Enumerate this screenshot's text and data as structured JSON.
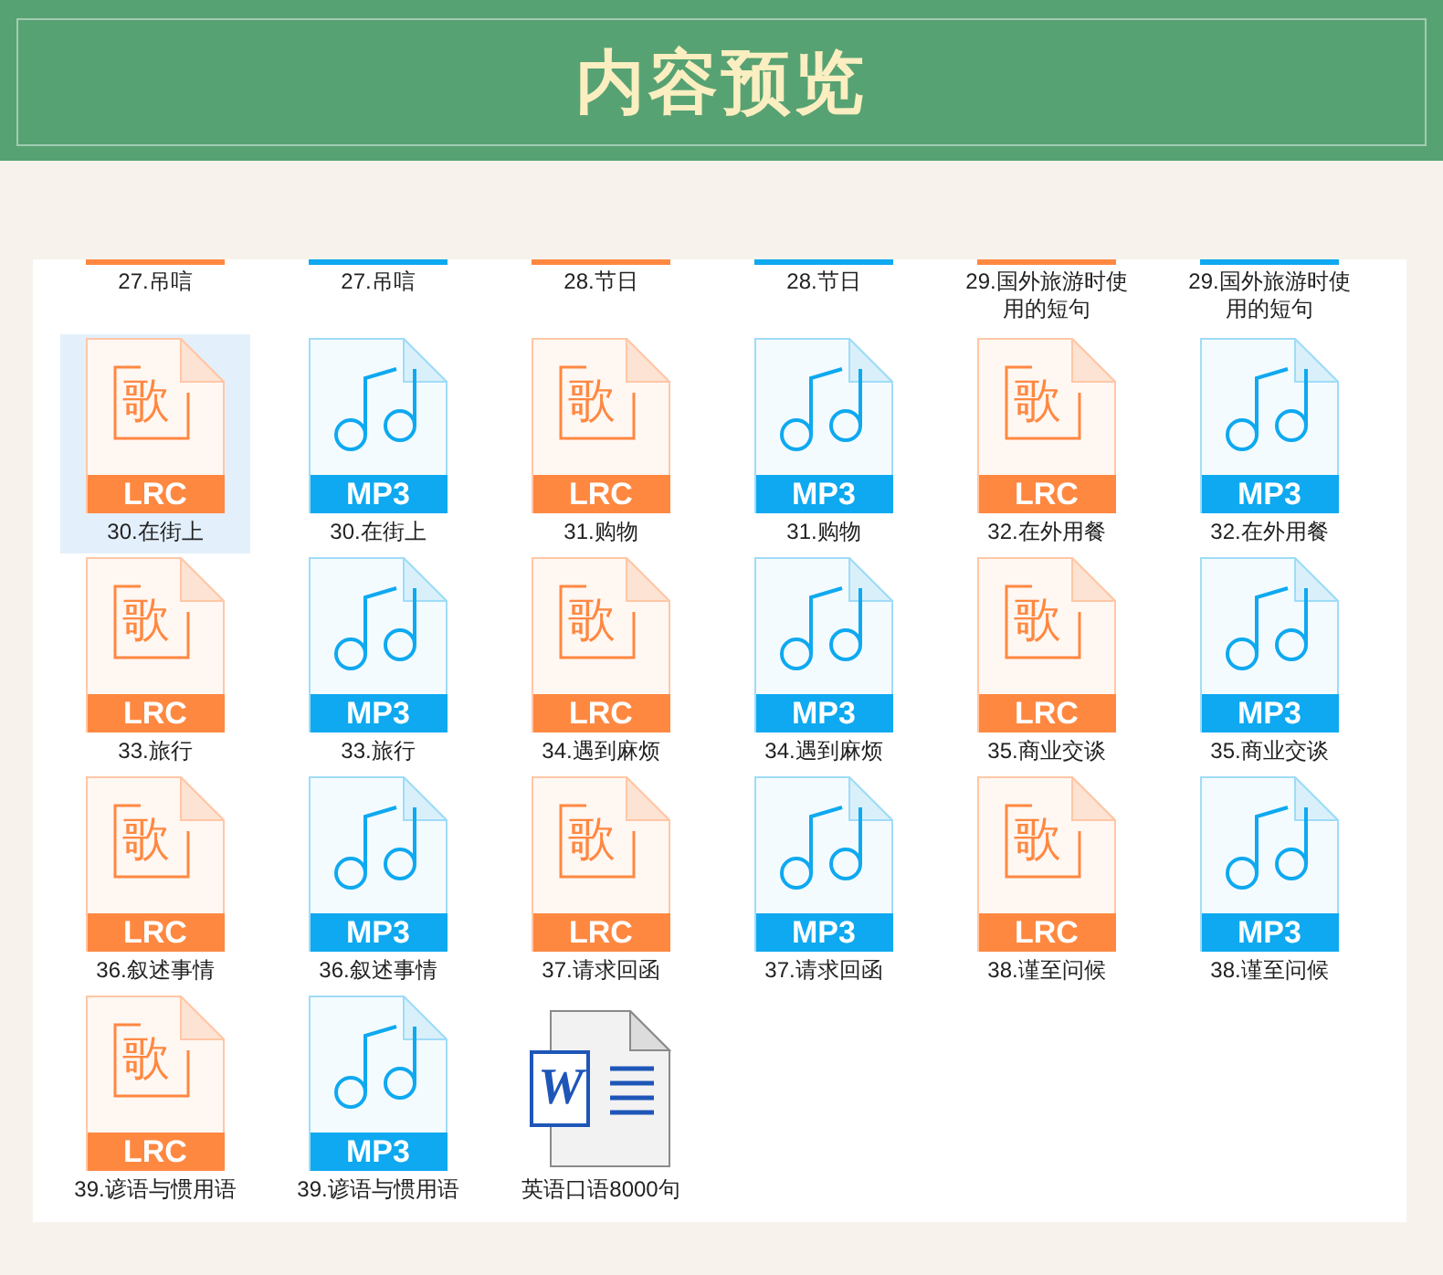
{
  "header": {
    "title": "内容预览"
  },
  "top_row": [
    {
      "label": "27.吊唁",
      "kind": "lrc"
    },
    {
      "label": "27.吊唁",
      "kind": "mp3"
    },
    {
      "label": "28.节日",
      "kind": "lrc"
    },
    {
      "label": "28.节日",
      "kind": "mp3"
    },
    {
      "label": "29.国外旅游时使用的短句",
      "kind": "lrc"
    },
    {
      "label": "29.国外旅游时使用的短句",
      "kind": "mp3"
    }
  ],
  "files": [
    {
      "label": "30.在街上",
      "kind": "lrc",
      "badge": "LRC",
      "glyph": "歌",
      "selected": true
    },
    {
      "label": "30.在街上",
      "kind": "mp3",
      "badge": "MP3",
      "selected": false
    },
    {
      "label": "31.购物",
      "kind": "lrc",
      "badge": "LRC",
      "glyph": "歌",
      "selected": false
    },
    {
      "label": "31.购物",
      "kind": "mp3",
      "badge": "MP3",
      "selected": false
    },
    {
      "label": "32.在外用餐",
      "kind": "lrc",
      "badge": "LRC",
      "glyph": "歌",
      "selected": false
    },
    {
      "label": "32.在外用餐",
      "kind": "mp3",
      "badge": "MP3",
      "selected": false
    },
    {
      "label": "33.旅行",
      "kind": "lrc",
      "badge": "LRC",
      "glyph": "歌",
      "selected": false
    },
    {
      "label": "33.旅行",
      "kind": "mp3",
      "badge": "MP3",
      "selected": false
    },
    {
      "label": "34.遇到麻烦",
      "kind": "lrc",
      "badge": "LRC",
      "glyph": "歌",
      "selected": false
    },
    {
      "label": "34.遇到麻烦",
      "kind": "mp3",
      "badge": "MP3",
      "selected": false
    },
    {
      "label": "35.商业交谈",
      "kind": "lrc",
      "badge": "LRC",
      "glyph": "歌",
      "selected": false
    },
    {
      "label": "35.商业交谈",
      "kind": "mp3",
      "badge": "MP3",
      "selected": false
    },
    {
      "label": "36.叙述事情",
      "kind": "lrc",
      "badge": "LRC",
      "glyph": "歌",
      "selected": false
    },
    {
      "label": "36.叙述事情",
      "kind": "mp3",
      "badge": "MP3",
      "selected": false
    },
    {
      "label": "37.请求回函",
      "kind": "lrc",
      "badge": "LRC",
      "glyph": "歌",
      "selected": false
    },
    {
      "label": "37.请求回函",
      "kind": "mp3",
      "badge": "MP3",
      "selected": false
    },
    {
      "label": "38.谨至问候",
      "kind": "lrc",
      "badge": "LRC",
      "glyph": "歌",
      "selected": false
    },
    {
      "label": "38.谨至问候",
      "kind": "mp3",
      "badge": "MP3",
      "selected": false
    },
    {
      "label": "39.谚语与惯用语",
      "kind": "lrc",
      "badge": "LRC",
      "glyph": "歌",
      "selected": false
    },
    {
      "label": "39.谚语与惯用语",
      "kind": "mp3",
      "badge": "MP3",
      "selected": false
    },
    {
      "label": "英语口语8000句",
      "kind": "doc",
      "badge": "W",
      "selected": false
    }
  ]
}
